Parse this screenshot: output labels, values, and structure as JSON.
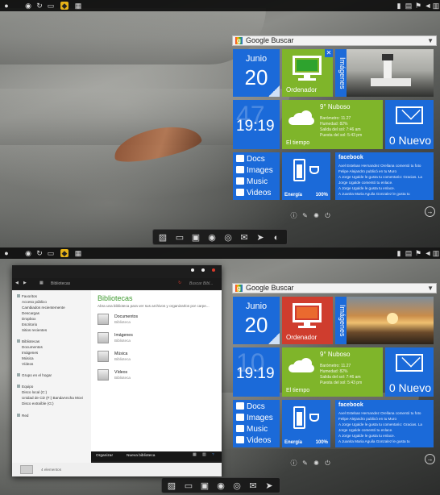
{
  "screens": [
    {
      "search": {
        "text": "Google Buscar"
      },
      "calendar": {
        "month": "Junio",
        "day": "20"
      },
      "pc_tile": {
        "label": "Ordenador",
        "close_glyph": "✕",
        "screen_color": "#2ea32e"
      },
      "images_tile": {
        "label": "Imágenes"
      },
      "clock": {
        "ghost": "47",
        "time": "19:19"
      },
      "weather": {
        "temp": "9° Nuboso",
        "details": [
          "Barómetro: 11.27",
          "Humedad: 82%",
          "Salida del sol: 7:46 am",
          "Puesta del sol: 5:43 pm"
        ],
        "label": "El tiempo"
      },
      "mail": {
        "label": "0 Nuevo"
      },
      "libraries": [
        "Docs",
        "Images",
        "Music",
        "Videos"
      ],
      "energy": {
        "label": "Energía",
        "percent": "100%",
        "level": 0.86
      },
      "facebook": {
        "title": "facebook",
        "posts": [
          "Axel Esteban Hernandez Orellana comentó tu foto",
          "Felipe Alejandro publicó en tu Muro",
          "A Jorge Ugalde le gusta tu comentario: Gracias. La",
          "Jorge Ugalde comentó tu enlace.",
          "A Jorge Ugalde le gusta tu enlace.",
          "A Juanita Maria Aguila Gonzalez le gusta tu"
        ]
      }
    },
    {
      "search": {
        "text": "Google Buscar"
      },
      "calendar": {
        "month": "Junio",
        "day": "20"
      },
      "pc_tile": {
        "label": "Ordenador",
        "close_glyph": "",
        "screen_color": "#ea6a2f"
      },
      "images_tile": {
        "label": "Imágenes"
      },
      "clock": {
        "ghost": "10",
        "time": "19:19"
      },
      "weather": {
        "temp": "9° Nuboso",
        "details": [
          "Barómetro: 11.27",
          "Humedad: 82%",
          "Salida del sol: 7:46 am",
          "Puesta del sol: 5:43 pm"
        ],
        "label": "El tiempo"
      },
      "mail": {
        "label": "0 Nuevo"
      },
      "libraries": [
        "Docs",
        "Images",
        "Music",
        "Videos"
      ],
      "energy": {
        "label": "Energía",
        "percent": "100%",
        "level": 0.86
      },
      "facebook": {
        "title": "facebook",
        "posts": [
          "Axel Esteban Hernandez Orellana comentó tu foto",
          "Felipe Alejandro publicó en tu Muro",
          "A Jorge Ugalde le gusta tu comentario: Gracias. La",
          "Jorge Ugalde comentó tu enlace.",
          "A Jorge Ugalde le gusta tu enlace.",
          "A Juanita Maria Aguila Gonzalez le gusta tu"
        ]
      }
    }
  ],
  "explorer": {
    "address": "Bibliotecas",
    "search_placeholder": "Buscar Bibl...",
    "sidebar": {
      "favorites_header": "Favoritos",
      "favorites": [
        "Acceso público",
        "Cambiados recientemente",
        "Descargas",
        "Dropbox",
        "Escritorio",
        "Sitios recientes"
      ],
      "libraries_header": "Bibliotecas",
      "libraries": [
        "Documentos",
        "Imágenes",
        "Música",
        "Vídeos"
      ],
      "homegroup": "Grupo en el hogar",
      "computer_header": "Equipo",
      "drives": [
        "Disco local (C:)",
        "Unidad de CD (F:) BandaAncha Movi",
        "Disco extraíble (G:)"
      ],
      "network": "Red"
    },
    "main": {
      "title": "Bibliotecas",
      "subtitle": "Abra una biblioteca para ver sus archivos y organizarlos por carpe...",
      "items": [
        {
          "name": "Documentos",
          "kind": "Biblioteca"
        },
        {
          "name": "Imágenes",
          "kind": "Biblioteca"
        },
        {
          "name": "Música",
          "kind": "Biblioteca"
        },
        {
          "name": "Vídeos",
          "kind": "Biblioteca"
        }
      ]
    },
    "toolbar": {
      "organize": "Organizar",
      "new_library": "Nueva biblioteca"
    },
    "status": "4 elementos"
  },
  "colors": {
    "tile_blue": "#1b6ad9",
    "tile_green": "#7fb52a",
    "accent_red": "#d83a2b",
    "library_title_green": "#3e9a2f"
  }
}
